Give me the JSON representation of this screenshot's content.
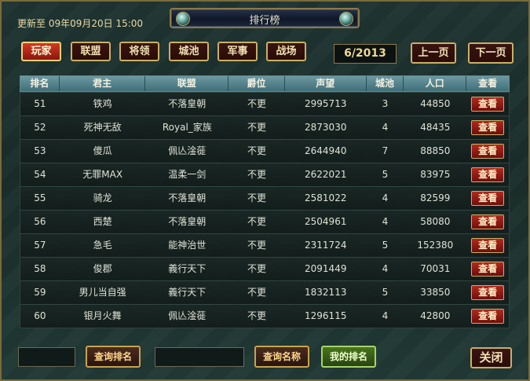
{
  "header": {
    "update_text": "更新至 09年09月20日 15:00",
    "title": "排行榜"
  },
  "tabs": [
    {
      "label": "玩家",
      "active": true
    },
    {
      "label": "联盟",
      "active": false
    },
    {
      "label": "将领",
      "active": false
    },
    {
      "label": "城池",
      "active": false
    },
    {
      "label": "军事",
      "active": false
    },
    {
      "label": "战场",
      "active": false
    }
  ],
  "pagination": {
    "current": "6/2013",
    "prev_label": "上一页",
    "next_label": "下一页"
  },
  "table": {
    "headers": [
      "排名",
      "君主",
      "联盟",
      "爵位",
      "声望",
      "城池",
      "人口",
      "查看"
    ],
    "view_label": "查看",
    "rows": [
      [
        "51",
        "铁鸡",
        "不落皇朝",
        "不更",
        "2995713",
        "3",
        "44850"
      ],
      [
        "52",
        "死神无敌",
        "Royal_家族",
        "不更",
        "2873030",
        "4",
        "48435"
      ],
      [
        "53",
        "傻瓜",
        "佩亾淦蓰",
        "不更",
        "2644940",
        "7",
        "88850"
      ],
      [
        "54",
        "无罪MAX",
        "温柔一剑",
        "不更",
        "2622021",
        "5",
        "83975"
      ],
      [
        "55",
        "骑龙",
        "不落皇朝",
        "不更",
        "2581022",
        "4",
        "82599"
      ],
      [
        "56",
        "西楚",
        "不落皇朝",
        "不更",
        "2504961",
        "4",
        "58080"
      ],
      [
        "57",
        "急毛",
        "能神治世",
        "不更",
        "2311724",
        "5",
        "152380"
      ],
      [
        "58",
        "俊郡",
        "義行天下",
        "不更",
        "2091449",
        "4",
        "70031"
      ],
      [
        "59",
        "男儿当自强",
        "義行天下",
        "不更",
        "1832113",
        "5",
        "33850"
      ],
      [
        "60",
        "银月火舞",
        "佩亾淦蓰",
        "不更",
        "1296115",
        "4",
        "42800"
      ]
    ]
  },
  "footer": {
    "rank_input_value": "",
    "query_rank_label": "查询排名",
    "name_input_value": "",
    "query_name_label": "查询名称",
    "my_rank_label": "我的排名",
    "close_label": "关闭"
  }
}
